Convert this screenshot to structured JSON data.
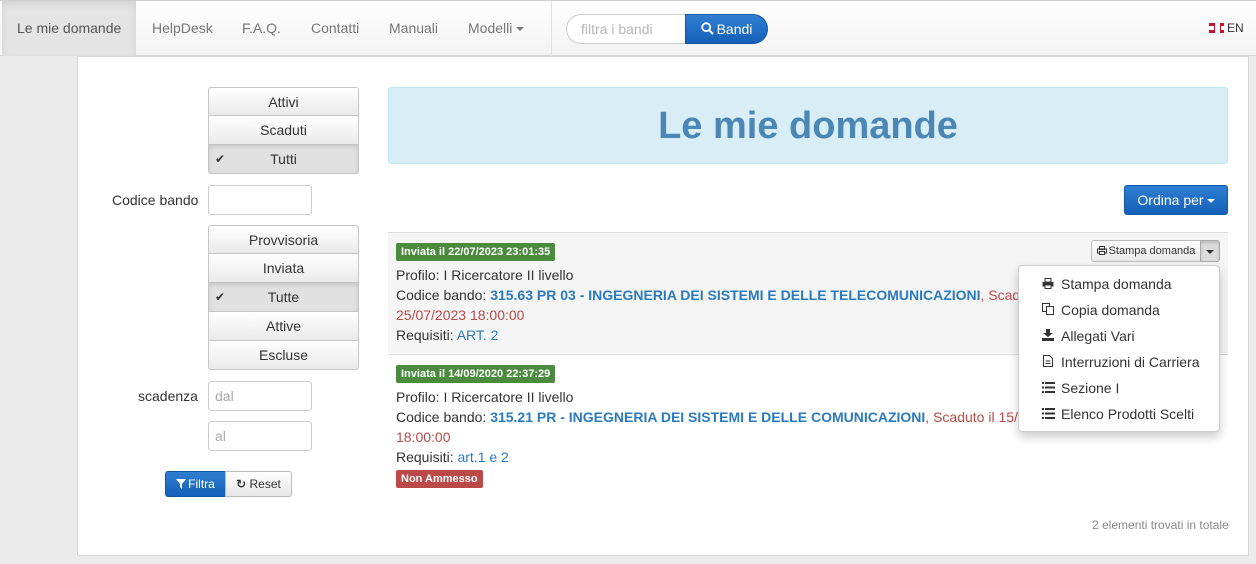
{
  "nav": {
    "items": [
      "Le mie domande",
      "HelpDesk",
      "F.A.Q.",
      "Contatti",
      "Manuali",
      "Modelli"
    ],
    "search_placeholder": "filtra i bandi",
    "search_button": "Bandi",
    "lang": "EN"
  },
  "sidebar": {
    "status_group": [
      {
        "label": "Attivi",
        "active": false
      },
      {
        "label": "Scaduti",
        "active": false
      },
      {
        "label": "Tutti",
        "active": true
      }
    ],
    "codice_label": "Codice bando",
    "state_group": [
      {
        "label": "Provvisoria",
        "active": false
      },
      {
        "label": "Inviata",
        "active": false
      },
      {
        "label": "Tutte",
        "active": true
      },
      {
        "label": "Attive",
        "active": false
      },
      {
        "label": "Escluse",
        "active": false
      }
    ],
    "scadenza_label": "scadenza",
    "dal_placeholder": "dal",
    "al_placeholder": "al",
    "filtra": "Filtra",
    "reset": "Reset"
  },
  "main": {
    "title": "Le mie domande",
    "ordina": "Ordina per",
    "items": [
      {
        "badge": "Inviata il 22/07/2023 23:01:35",
        "profilo": "Profilo: I Ricercatore II livello",
        "codice_prefix": "Codice bando: ",
        "codice": "315.63 PR 03 - INGEGNERIA DEI SISTEMI E DELLE TELECOMUNICAZIONI",
        "scadenza_1": ", Scad",
        "scadenza_2": "25/07/2023 18:00:00",
        "requisiti_prefix": "Requisiti: ",
        "requisiti": "ART. 2"
      },
      {
        "badge": "Inviata il 14/09/2020 22:37:29",
        "profilo": "Profilo: I Ricercatore II livello",
        "codice_prefix": "Codice bando: ",
        "codice": "315.21 PR - INGEGNERIA DEI SISTEMI E DELLE COMUNICAZIONI",
        "scadenza_1": ", Scaduto il 15/",
        "scadenza_2": "18:00:00",
        "requisiti_prefix": "Requisiti: ",
        "requisiti": "art.1 e 2",
        "status_badge": "Non Ammesso"
      }
    ],
    "stampa_button": "Stampa domanda",
    "dropdown": [
      {
        "label": "Stampa domanda",
        "icon": "print-icon"
      },
      {
        "label": "Copia domanda",
        "icon": "copy-icon"
      },
      {
        "label": "Allegati Vari",
        "icon": "download-icon"
      },
      {
        "label": "Interruzioni di Carriera",
        "icon": "file-icon"
      },
      {
        "label": "Sezione I",
        "icon": "list-icon"
      },
      {
        "label": "Elenco Prodotti Scelti",
        "icon": "list-icon"
      }
    ],
    "count": "2 elementi trovati in totale"
  },
  "colors": {
    "primary": "#1560b9",
    "success": "#4a8b3e",
    "danger": "#b94a48",
    "title": "#4a87b5"
  }
}
